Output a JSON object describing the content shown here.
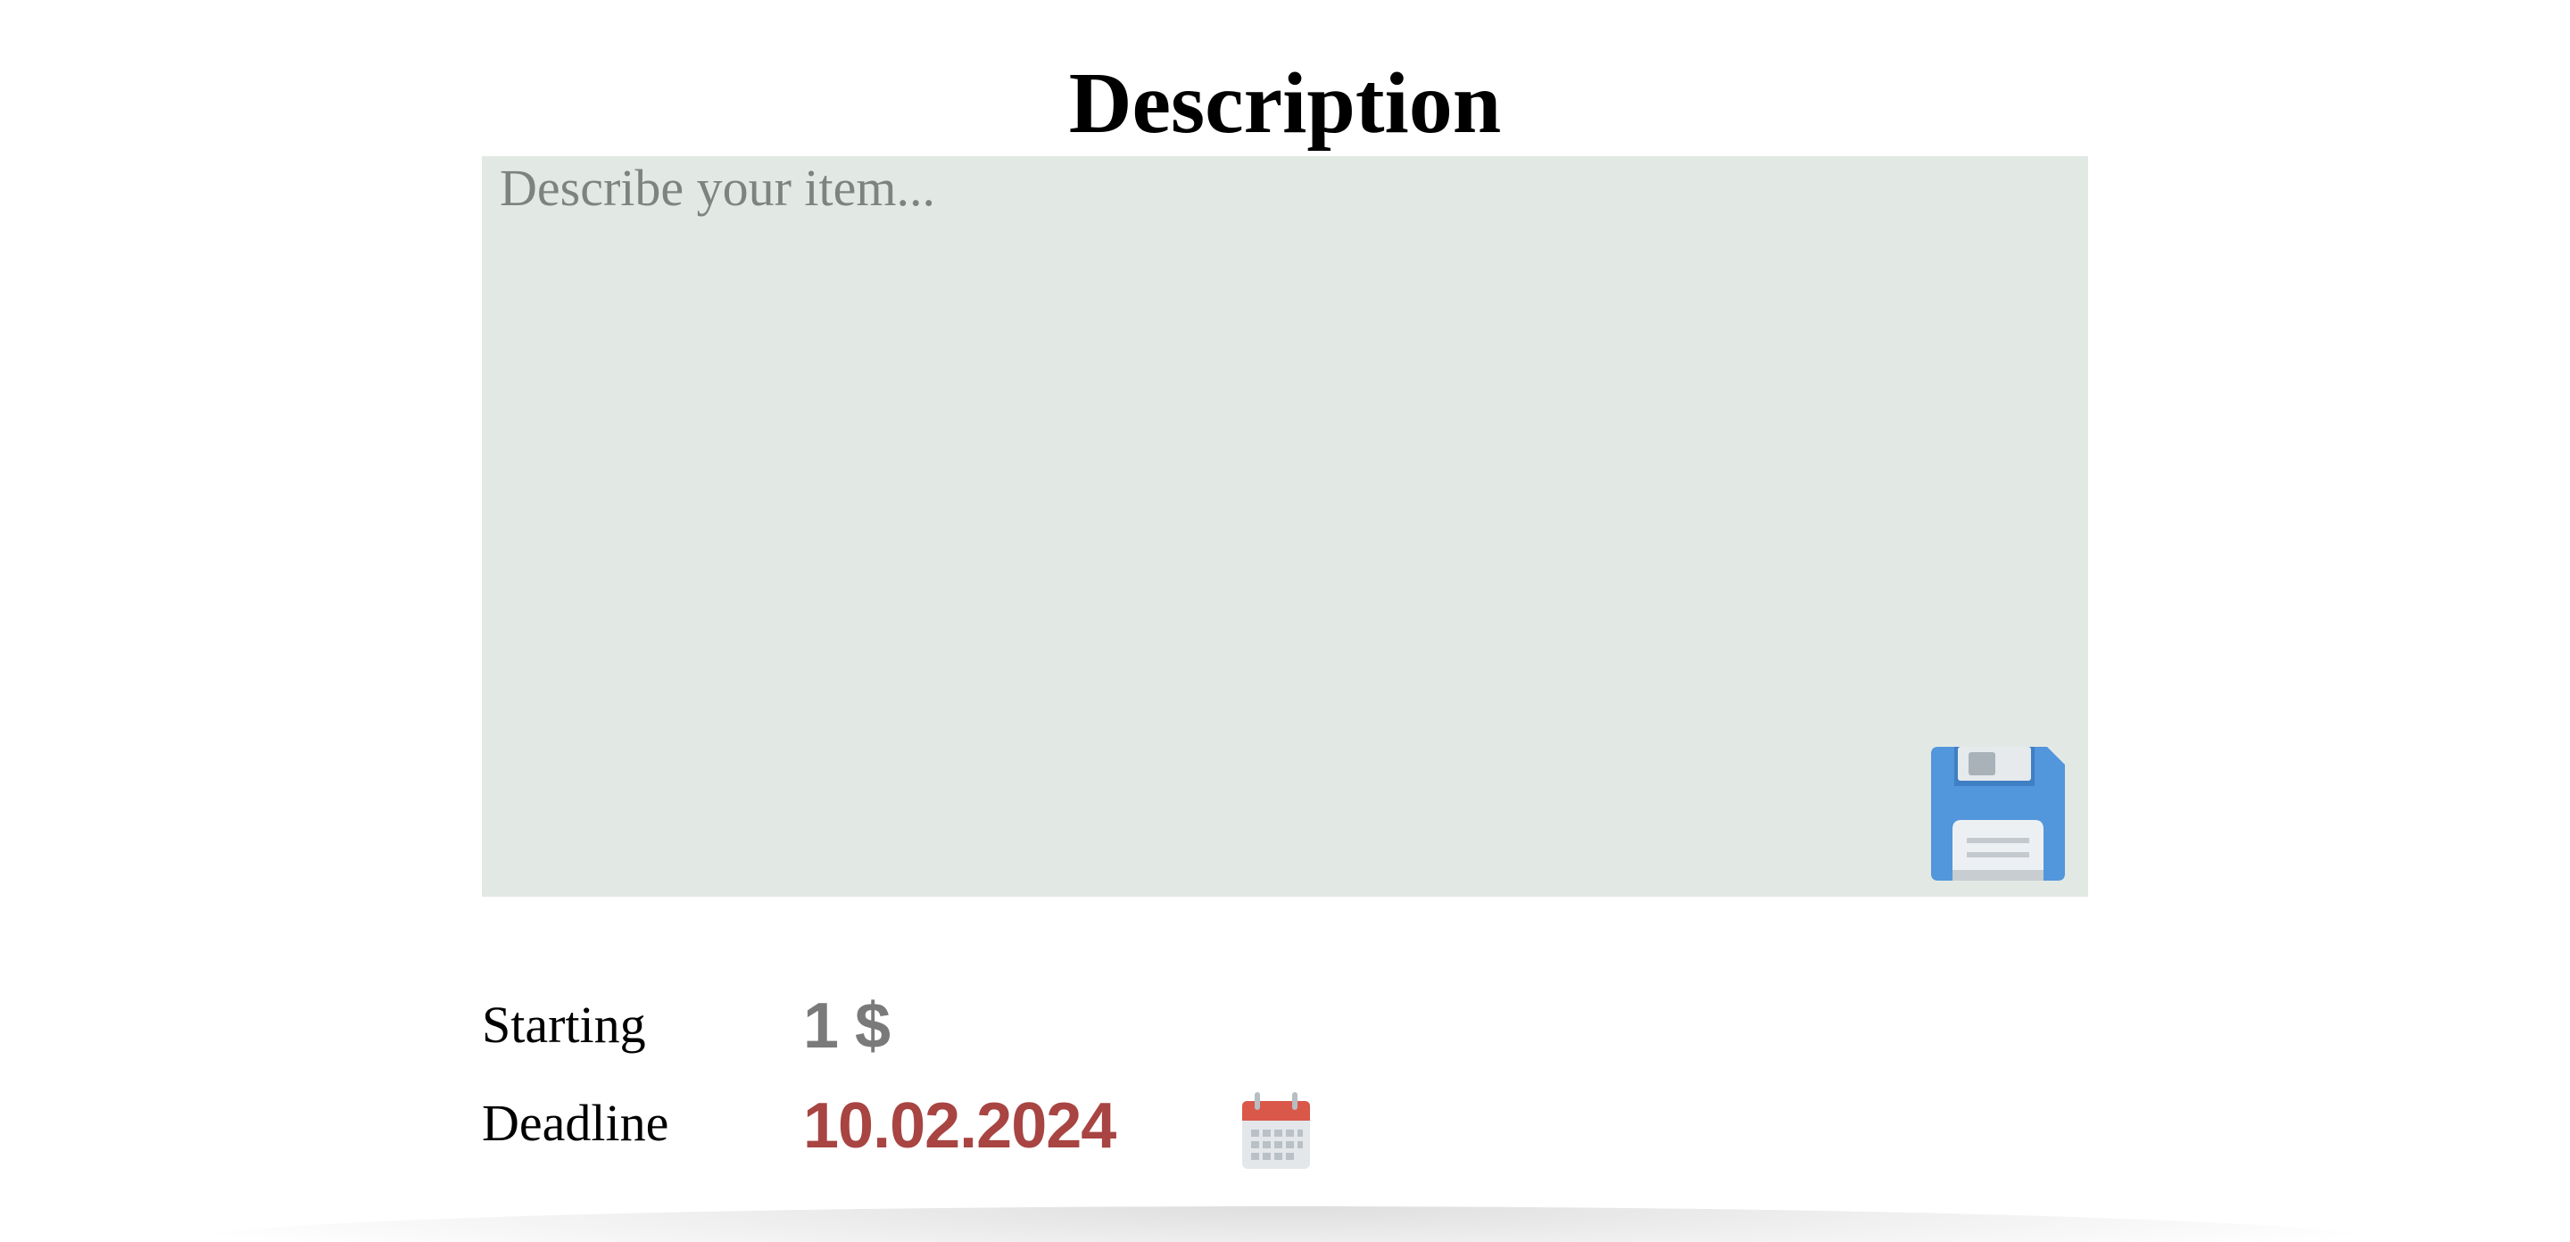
{
  "title": "Description",
  "description": {
    "placeholder": "Describe your item...",
    "value": ""
  },
  "save_icon": "floppy-disk-save-icon",
  "fields": {
    "starting": {
      "label": "Starting",
      "value": "1 $",
      "color": "#7a7a7a"
    },
    "deadline": {
      "label": "Deadline",
      "value": "10.02.2024",
      "color": "#a84442",
      "icon": "calendar-icon"
    }
  },
  "colors": {
    "textarea_background": "#e2e9e5",
    "save_icon_blue": "#5296db",
    "calendar_red": "#d9584a"
  }
}
